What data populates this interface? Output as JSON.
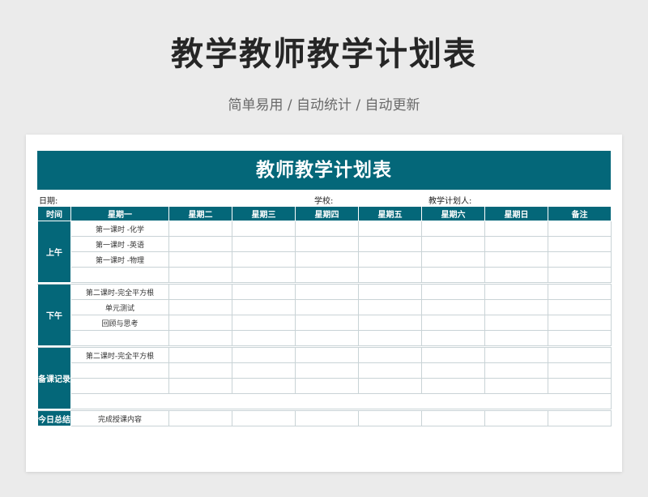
{
  "page": {
    "title": "教学教师教学计划表",
    "subtitle": "简单易用 / 自动统计 / 自动更新"
  },
  "sheet": {
    "title": "教师教学计划表",
    "date_label": "日期:",
    "school_label": "学校:",
    "planner_label": "教学计划人:",
    "headers": [
      "时间",
      "星期一",
      "星期二",
      "星期三",
      "星期四",
      "星期五",
      "星期六",
      "星期日",
      "备注"
    ],
    "sections": {
      "morning": {
        "label": "上午",
        "rows": [
          "第一课时 -化学",
          "第一课时 -英语",
          "第一课时 -物理",
          ""
        ]
      },
      "afternoon": {
        "label": "下午",
        "rows": [
          "第二课时-完全平方根",
          "单元测试",
          "回顾与思考",
          ""
        ]
      },
      "prep": {
        "label": "备课记录",
        "rows": [
          "第二课时-完全平方根",
          "",
          "",
          ""
        ]
      },
      "summary": {
        "label": "今日总结",
        "content": "完成授课内容"
      }
    },
    "colors": {
      "primary": "#046779",
      "background": "#ebebeb",
      "grid_line": "#c9d3d6"
    }
  }
}
